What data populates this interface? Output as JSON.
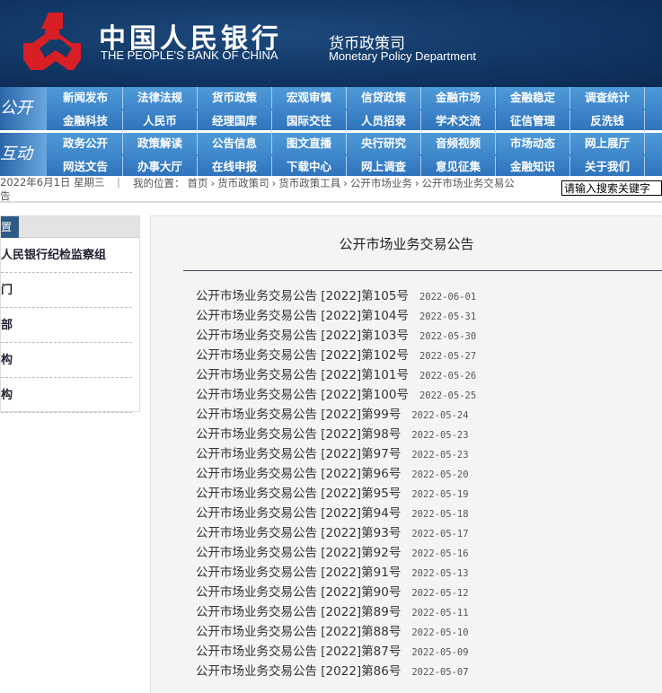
{
  "header": {
    "name_cn": "中国人民银行",
    "name_en": "THE PEOPLE'S BANK OF CHINA",
    "dept_cn": "货币政策司",
    "dept_en": "Monetary Policy Department"
  },
  "nav": {
    "groups": [
      {
        "label": "公开",
        "rows": [
          [
            "新闻发布",
            "法律法规",
            "货币政策",
            "宏观审慎",
            "信贷政策",
            "金融市场",
            "金融稳定",
            "调查统计",
            ""
          ],
          [
            "金融科技",
            "人民币",
            "经理国库",
            "国际交往",
            "人员招录",
            "学术交流",
            "征信管理",
            "反洗钱",
            ""
          ]
        ]
      },
      {
        "label": "互动",
        "rows": [
          [
            "政务公开",
            "政策解读",
            "公告信息",
            "图文直播",
            "央行研究",
            "音频视频",
            "市场动态",
            "网上展厅",
            ""
          ],
          [
            "网送文告",
            "办事大厅",
            "在线申报",
            "下载中心",
            "网上调查",
            "意见征集",
            "金融知识",
            "关于我们",
            ""
          ]
        ]
      }
    ]
  },
  "breadcrumb": {
    "date": "2022年6月1日 星期三",
    "sep": "|",
    "prefix": "我的位置：",
    "items": [
      "首页",
      "货币政策司",
      "货币政策工具",
      "公开市场业务",
      "公开市场业务交易公"
    ],
    "wrap": "告",
    "arrow": "›"
  },
  "search": {
    "placeholder": "请输入搜索关键字"
  },
  "sidebar": {
    "tab": "置",
    "items": [
      "人民银行纪检监察组",
      "门",
      "部",
      "构",
      "构"
    ]
  },
  "main": {
    "title": "公开市场业务交易公告",
    "items": [
      {
        "t": "公开市场业务交易公告 [2022]第105号",
        "d": "2022-06-01"
      },
      {
        "t": "公开市场业务交易公告 [2022]第104号",
        "d": "2022-05-31"
      },
      {
        "t": "公开市场业务交易公告 [2022]第103号",
        "d": "2022-05-30"
      },
      {
        "t": "公开市场业务交易公告 [2022]第102号",
        "d": "2022-05-27"
      },
      {
        "t": "公开市场业务交易公告 [2022]第101号",
        "d": "2022-05-26"
      },
      {
        "t": "公开市场业务交易公告 [2022]第100号",
        "d": "2022-05-25"
      },
      {
        "t": "公开市场业务交易公告 [2022]第99号",
        "d": "2022-05-24"
      },
      {
        "t": "公开市场业务交易公告 [2022]第98号",
        "d": "2022-05-23"
      },
      {
        "t": "公开市场业务交易公告 [2022]第97号",
        "d": "2022-05-23"
      },
      {
        "t": "公开市场业务交易公告 [2022]第96号",
        "d": "2022-05-20"
      },
      {
        "t": "公开市场业务交易公告 [2022]第95号",
        "d": "2022-05-19"
      },
      {
        "t": "公开市场业务交易公告 [2022]第94号",
        "d": "2022-05-18"
      },
      {
        "t": "公开市场业务交易公告 [2022]第93号",
        "d": "2022-05-17"
      },
      {
        "t": "公开市场业务交易公告 [2022]第92号",
        "d": "2022-05-16"
      },
      {
        "t": "公开市场业务交易公告 [2022]第91号",
        "d": "2022-05-13"
      },
      {
        "t": "公开市场业务交易公告 [2022]第90号",
        "d": "2022-05-12"
      },
      {
        "t": "公开市场业务交易公告 [2022]第89号",
        "d": "2022-05-11"
      },
      {
        "t": "公开市场业务交易公告 [2022]第88号",
        "d": "2022-05-10"
      },
      {
        "t": "公开市场业务交易公告 [2022]第87号",
        "d": "2022-05-09"
      },
      {
        "t": "公开市场业务交易公告 [2022]第86号",
        "d": "2022-05-07"
      }
    ]
  }
}
